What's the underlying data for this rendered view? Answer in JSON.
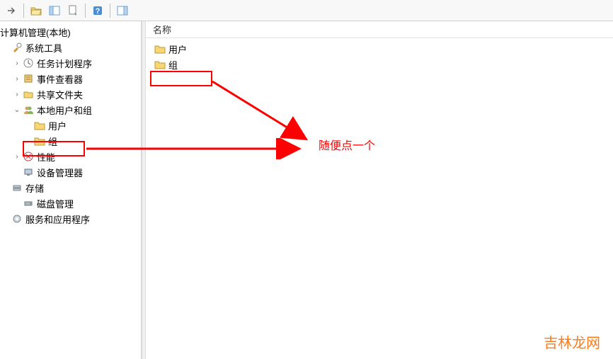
{
  "toolbar": {
    "icons": [
      "arrow-right",
      "folder-open",
      "panel",
      "refresh-doc",
      "help",
      "panel-alt"
    ]
  },
  "tree": {
    "root_label": "计算机管理(本地)",
    "system_tools": {
      "label": "系统工具",
      "items": [
        {
          "label": "任务计划程序",
          "icon": "clock"
        },
        {
          "label": "事件查看器",
          "icon": "event"
        },
        {
          "label": "共享文件夹",
          "icon": "share"
        },
        {
          "label": "本地用户和组",
          "icon": "users",
          "expanded": true,
          "children": [
            {
              "label": "用户",
              "icon": "folder"
            },
            {
              "label": "组",
              "icon": "folder",
              "highlighted": true
            }
          ]
        },
        {
          "label": "性能",
          "icon": "perf"
        },
        {
          "label": "设备管理器",
          "icon": "device"
        }
      ]
    },
    "storage": {
      "label": "存储",
      "items": [
        {
          "label": "磁盘管理",
          "icon": "disk"
        }
      ]
    },
    "services": {
      "label": "服务和应用程序",
      "icon": "services"
    }
  },
  "list": {
    "header": "名称",
    "items": [
      {
        "label": "用户"
      },
      {
        "label": "组",
        "highlighted": true
      }
    ]
  },
  "annotation": {
    "text": "随便点一个"
  },
  "watermark": "吉林龙网"
}
